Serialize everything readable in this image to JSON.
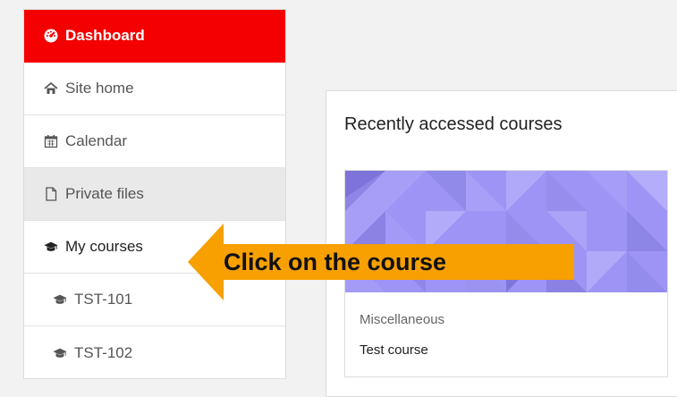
{
  "sidebar": {
    "items": [
      {
        "label": "Dashboard",
        "icon": "tachometer-icon"
      },
      {
        "label": "Site home",
        "icon": "home-icon"
      },
      {
        "label": "Calendar",
        "icon": "calendar-icon"
      },
      {
        "label": "Private files",
        "icon": "file-icon"
      },
      {
        "label": "My courses",
        "icon": "graduation-cap-icon"
      },
      {
        "label": "TST-101",
        "icon": "graduation-cap-icon"
      },
      {
        "label": "TST-102",
        "icon": "graduation-cap-icon"
      }
    ]
  },
  "main": {
    "recent_title": "Recently accessed courses",
    "course": {
      "category": "Miscellaneous",
      "name": "Test course"
    }
  },
  "annotation": {
    "text": "Click on the course",
    "color": "#f7a000"
  },
  "colors": {
    "accent": "#f40000",
    "course_image": "#9d94f5"
  }
}
